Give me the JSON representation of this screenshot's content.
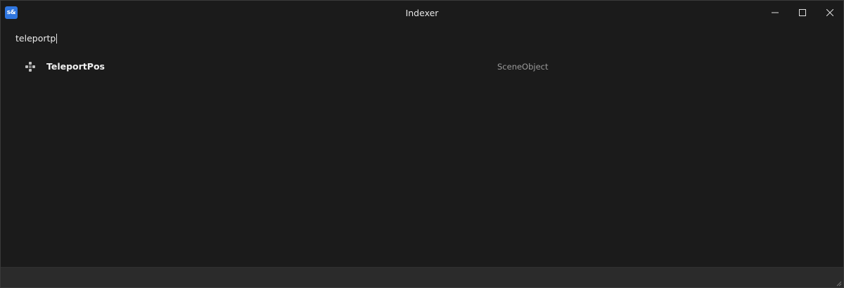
{
  "window": {
    "title": "Indexer",
    "logo_text": "s&"
  },
  "titlebar_buttons": {
    "minimize_icon": "minimize-icon",
    "maximize_icon": "maximize-icon",
    "close_icon": "close-icon"
  },
  "search": {
    "value": "teleportp"
  },
  "results": [
    {
      "name": "TeleportPos",
      "type": "SceneObject",
      "icon": "gamepad-icon"
    }
  ],
  "colors": {
    "background": "#1b1b1b",
    "footer": "#2b2b2b",
    "accent": "#2f76e0",
    "muted_text": "#9a9a9a"
  }
}
